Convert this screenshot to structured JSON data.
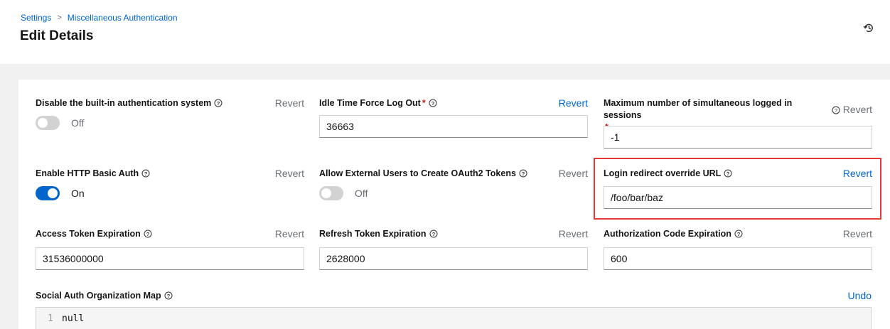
{
  "breadcrumb": {
    "root": "Settings",
    "separator": ">",
    "current": "Miscellaneous Authentication"
  },
  "title": "Edit Details",
  "fields": {
    "disable_builtin_auth": {
      "label": "Disable the built-in authentication system",
      "revert": "Revert",
      "toggle_text": "Off",
      "enabled": false
    },
    "idle_time": {
      "label": "Idle Time Force Log Out",
      "required": "*",
      "revert": "Revert",
      "value": "36663"
    },
    "max_sessions": {
      "label": "Maximum number of simultaneous logged in sessions",
      "required": "*",
      "revert": "Revert",
      "value": "-1"
    },
    "http_basic_auth": {
      "label": "Enable HTTP Basic Auth",
      "revert": "Revert",
      "toggle_text": "On",
      "enabled": true
    },
    "external_oauth": {
      "label": "Allow External Users to Create OAuth2 Tokens",
      "revert": "Revert",
      "toggle_text": "Off",
      "enabled": false
    },
    "login_redirect": {
      "label": "Login redirect override URL",
      "revert": "Revert",
      "value": "/foo/bar/baz"
    },
    "access_token": {
      "label": "Access Token Expiration",
      "revert": "Revert",
      "value": "31536000000"
    },
    "refresh_token": {
      "label": "Refresh Token Expiration",
      "revert": "Revert",
      "value": "2628000"
    },
    "auth_code": {
      "label": "Authorization Code Expiration",
      "revert": "Revert",
      "value": "600"
    },
    "social_org_map": {
      "label": "Social Auth Organization Map",
      "undo": "Undo",
      "line_number": "1",
      "code": "null"
    }
  },
  "colors": {
    "link": "#0066cc",
    "toggle_on": "#0066cc",
    "toggle_off": "#d2d2d2",
    "required": "#c9190b",
    "highlight": "#e53935"
  },
  "icons": {
    "help": "question-circle-icon",
    "history": "history-icon"
  }
}
